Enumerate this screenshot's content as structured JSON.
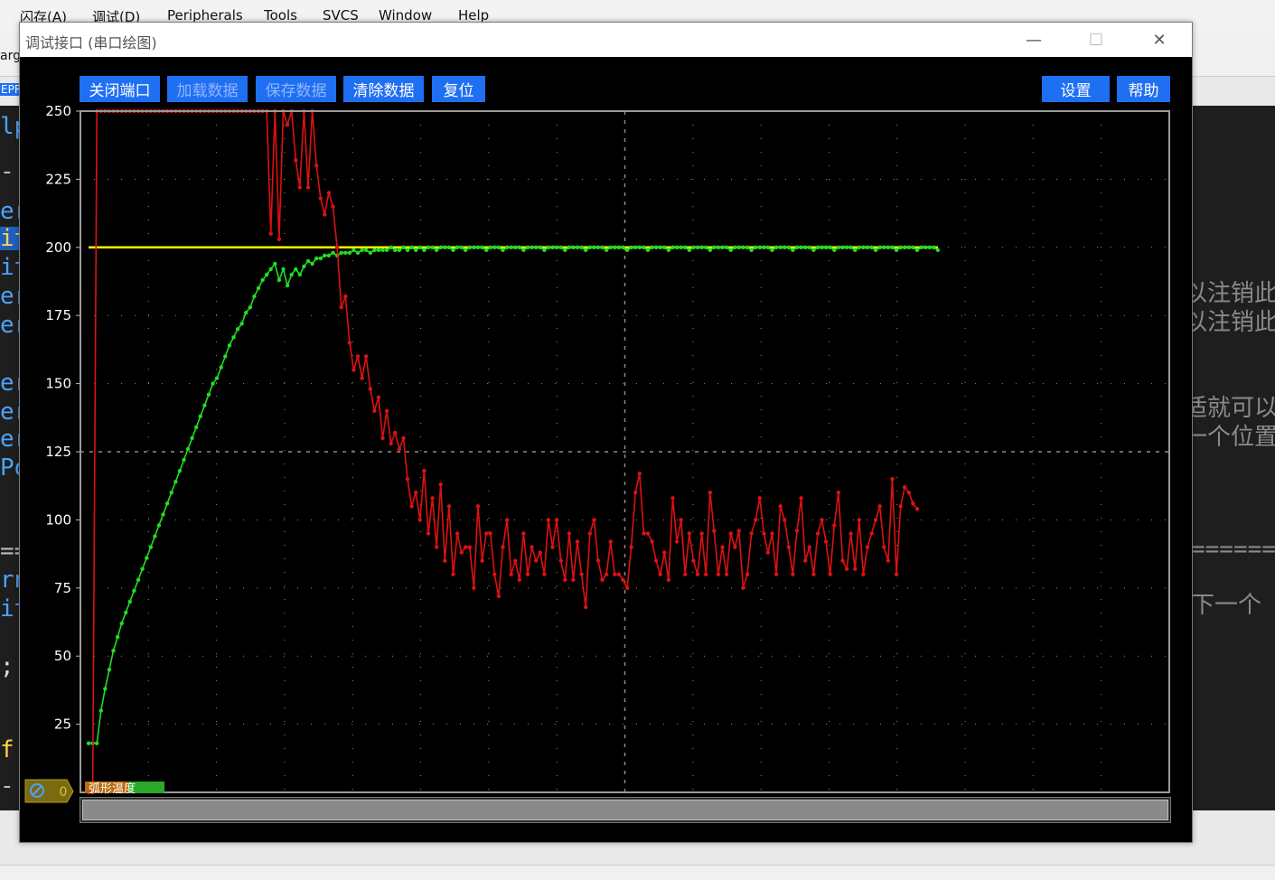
{
  "ide": {
    "menu": [
      "闪存(A)",
      "调试(D)",
      "Peripherals",
      "Tools",
      "SVCS",
      "Window",
      "Help"
    ],
    "left_fragments": [
      "arg",
      "EPR",
      "lp",
      "-",
      "er",
      "it",
      "it",
      "er",
      "er",
      "er",
      "er",
      "er",
      "Po",
      "==",
      "rn",
      "it",
      ";",
      "f",
      "-"
    ],
    "right_fragments": [
      "以注销此",
      "以注销此",
      "适就可以",
      "一个位置",
      "======",
      "下一个"
    ]
  },
  "window": {
    "title": "调试接口 (串口绘图)",
    "minimize_glyph": "—",
    "maximize_glyph": "☐",
    "close_glyph": "✕"
  },
  "toolbar": {
    "close_port": "关闭端口",
    "load_data": "加载数据",
    "save_data": "保存数据",
    "clear_data": "清除数据",
    "reset": "复位",
    "settings": "设置",
    "help": "帮助"
  },
  "legend": {
    "marker_value": "0",
    "tag_text": "弧形温度"
  },
  "chart_data": {
    "type": "line",
    "ylim": [
      0,
      250
    ],
    "yticks": [
      25,
      50,
      75,
      100,
      125,
      150,
      175,
      200,
      225,
      250
    ],
    "xlim": [
      0,
      200
    ],
    "grid": true,
    "background": "#000000",
    "series": [
      {
        "color": "#ffff00",
        "values": [
          200,
          200,
          200,
          200,
          200,
          200,
          200,
          200,
          200,
          200,
          200,
          200,
          200,
          200,
          200,
          200,
          200,
          200,
          200,
          200,
          200,
          200,
          200,
          200,
          200,
          200,
          200,
          200,
          200,
          200,
          200,
          200,
          200,
          200,
          200,
          200,
          200,
          200,
          200,
          200,
          200,
          200,
          200,
          200,
          200,
          200,
          200,
          200,
          200,
          200,
          200,
          200,
          200,
          200,
          200,
          200,
          200,
          200,
          200,
          200,
          200,
          200,
          200,
          200,
          200,
          200,
          200,
          200,
          200,
          200,
          200,
          200,
          200,
          200,
          200,
          200,
          200,
          200,
          200,
          200,
          200,
          200,
          200,
          200,
          200,
          200,
          200,
          200,
          200,
          200,
          200,
          200,
          200,
          200,
          200,
          200,
          200,
          200,
          200,
          200,
          200,
          200,
          200,
          200,
          200,
          200,
          200,
          200,
          200,
          200,
          200,
          200,
          200,
          200,
          200,
          200,
          200,
          200,
          200,
          200,
          200,
          200,
          200,
          200,
          200,
          200,
          200,
          200,
          200,
          200,
          200,
          200,
          200,
          200,
          200,
          200,
          200,
          200,
          200,
          200,
          200,
          200,
          200,
          200,
          200,
          200,
          200,
          200,
          200,
          200,
          200,
          200,
          200,
          200,
          200,
          200,
          200,
          200,
          200,
          200,
          200,
          200,
          200,
          200,
          200,
          200,
          200,
          200,
          200,
          200,
          200,
          200,
          200,
          200,
          200,
          200,
          200,
          200,
          200,
          200,
          200,
          200,
          200,
          200,
          200,
          200,
          200,
          200,
          200,
          200,
          200,
          200,
          200,
          200,
          200,
          200,
          200,
          200,
          200,
          200,
          200,
          200,
          200,
          200,
          200,
          200
        ]
      },
      {
        "color": "#22dd22",
        "values": [
          18,
          18,
          18,
          30,
          38,
          45,
          52,
          57,
          62,
          66,
          70,
          74,
          78,
          82,
          86,
          90,
          94,
          98,
          102,
          106,
          110,
          114,
          118,
          122,
          126,
          130,
          134,
          138,
          142,
          146,
          150,
          152,
          156,
          160,
          164,
          167,
          170,
          172,
          176,
          178,
          182,
          185,
          188,
          190,
          192,
          194,
          188,
          192,
          186,
          190,
          192,
          190,
          193,
          195,
          194,
          196,
          196,
          197,
          197,
          198,
          197,
          198,
          198,
          198,
          199,
          198,
          199,
          199,
          198,
          199,
          199,
          199,
          199,
          200,
          199,
          199,
          200,
          199,
          200,
          199,
          200,
          199,
          200,
          200,
          199,
          200,
          200,
          200,
          199,
          200,
          200,
          199,
          200,
          200,
          200,
          200,
          199,
          200,
          200,
          200,
          199,
          200,
          200,
          200,
          200,
          199,
          200,
          200,
          200,
          200,
          199,
          200,
          200,
          200,
          200,
          199,
          200,
          200,
          200,
          200,
          199,
          200,
          200,
          200,
          200,
          199,
          200,
          200,
          200,
          200,
          199,
          200,
          200,
          200,
          200,
          199,
          200,
          200,
          200,
          200,
          199,
          200,
          200,
          200,
          200,
          199,
          200,
          200,
          200,
          200,
          199,
          200,
          200,
          200,
          200,
          199,
          200,
          200,
          200,
          200,
          199,
          200,
          200,
          200,
          200,
          199,
          200,
          200,
          200,
          200,
          199,
          200,
          200,
          200,
          200,
          199,
          200,
          200,
          200,
          200,
          199,
          200,
          200,
          200,
          200,
          199,
          200,
          200,
          200,
          200,
          199,
          200,
          200,
          200,
          200,
          199,
          200,
          200,
          200,
          200,
          199,
          200,
          200,
          200,
          200,
          199
        ]
      },
      {
        "color": "#dd1111",
        "values": [
          0,
          0,
          250,
          250,
          250,
          250,
          250,
          250,
          250,
          250,
          250,
          250,
          250,
          250,
          250,
          250,
          250,
          250,
          250,
          250,
          250,
          250,
          250,
          250,
          250,
          250,
          250,
          250,
          250,
          250,
          250,
          250,
          250,
          250,
          250,
          250,
          250,
          250,
          250,
          250,
          250,
          250,
          250,
          250,
          205,
          250,
          203,
          250,
          245,
          250,
          232,
          222,
          250,
          222,
          250,
          230,
          218,
          212,
          220,
          215,
          200,
          178,
          182,
          165,
          155,
          160,
          152,
          160,
          148,
          140,
          145,
          130,
          140,
          128,
          132,
          126,
          130,
          115,
          105,
          110,
          100,
          118,
          95,
          108,
          90,
          113,
          85,
          105,
          80,
          95,
          88,
          90,
          90,
          75,
          105,
          85,
          95,
          95,
          80,
          72,
          90,
          100,
          80,
          85,
          78,
          95,
          80,
          90,
          85,
          88,
          80,
          100,
          90,
          100,
          85,
          78,
          95,
          78,
          92,
          80,
          68,
          95,
          100,
          85,
          78,
          80,
          92,
          80,
          80,
          78,
          75,
          90,
          110,
          117,
          95,
          95,
          92,
          85,
          80,
          88,
          78,
          108,
          92,
          100,
          80,
          95,
          85,
          80,
          95,
          80,
          110,
          96,
          80,
          90,
          80,
          95,
          90,
          96,
          75,
          80,
          95,
          100,
          108,
          95,
          88,
          95,
          80,
          105,
          100,
          90,
          80,
          96,
          108,
          85,
          90,
          80,
          95,
          100,
          92,
          80,
          98,
          110,
          85,
          82,
          95,
          82,
          100,
          80,
          90,
          95,
          100,
          105,
          90,
          85,
          115,
          80,
          105,
          112,
          110,
          106,
          104
        ]
      }
    ]
  }
}
